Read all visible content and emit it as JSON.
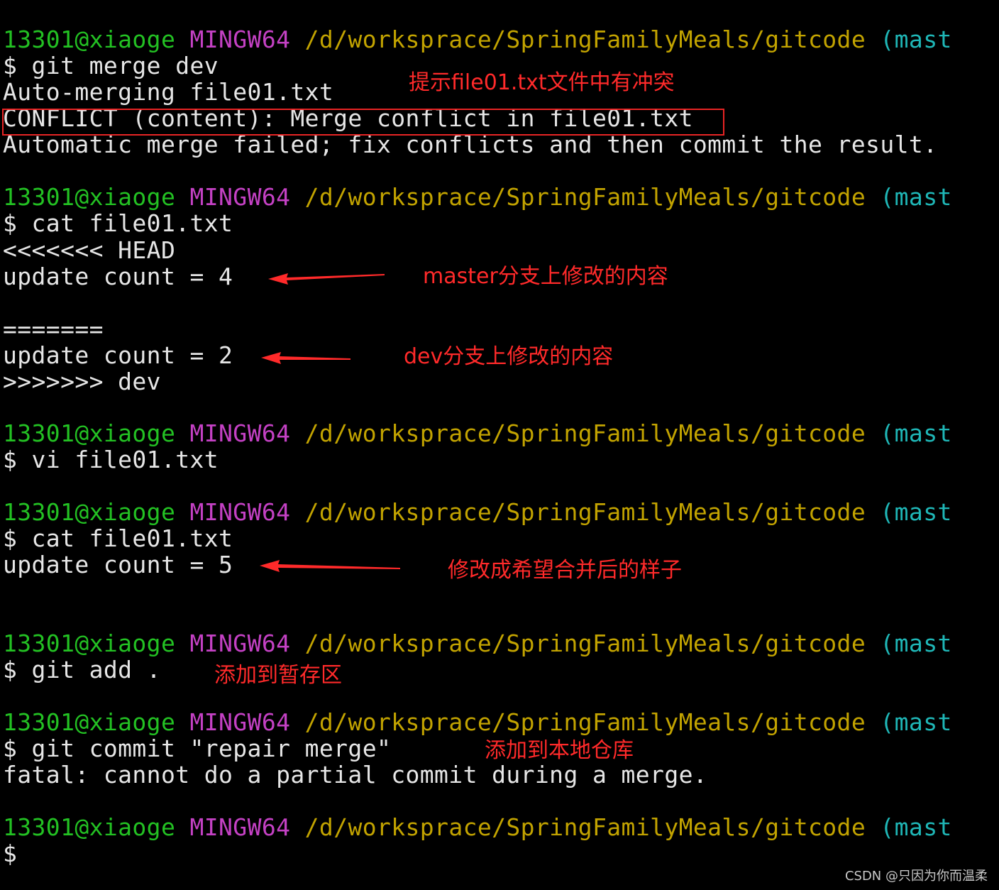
{
  "terminal": {
    "prompt": {
      "user_host": "13301@xiaoge",
      "system": "MINGW64",
      "path": "/d/worksprace/SpringFamilyMeals/gitcode",
      "branch": "(mast",
      "dollar": "$"
    },
    "lines": {
      "cmd_merge": "$ git merge dev",
      "out_automerge": "Auto-merging file01.txt",
      "out_conflict": "CONFLICT (content): Merge conflict in file01.txt",
      "out_failed": "Automatic merge failed; fix conflicts and then commit the result.",
      "cmd_cat1": "$ cat file01.txt",
      "out_head": "<<<<<<< HEAD",
      "out_master_val": "update count = 4",
      "out_sep": "=======",
      "out_dev_val": "update count = 2",
      "out_dev_marker": ">>>>>>> dev",
      "cmd_vi": "$ vi file01.txt",
      "cmd_cat2": "$ cat file01.txt",
      "out_merged_val": "update count = 5",
      "cmd_add": "$ git add .",
      "cmd_commit": "$ git commit \"repair merge\"",
      "out_fatal": "fatal: cannot do a partial commit during a merge."
    }
  },
  "annotations": {
    "conflict_hint": "提示file01.txt文件中有冲突",
    "master_content": "master分支上修改的内容",
    "dev_content": "dev分支上修改的内容",
    "merged_content": "修改成希望合并后的样子",
    "add_staging": "添加到暂存区",
    "add_local_repo": "添加到本地仓库"
  },
  "watermark": "CSDN @只因为你而温柔",
  "colors": {
    "background": "#000000",
    "text": "#e6e6e6",
    "user_host": "#23c123",
    "system": "#c441c4",
    "path": "#c2a300",
    "branch": "#1fb7b7",
    "annotation": "#ff2a2a"
  }
}
